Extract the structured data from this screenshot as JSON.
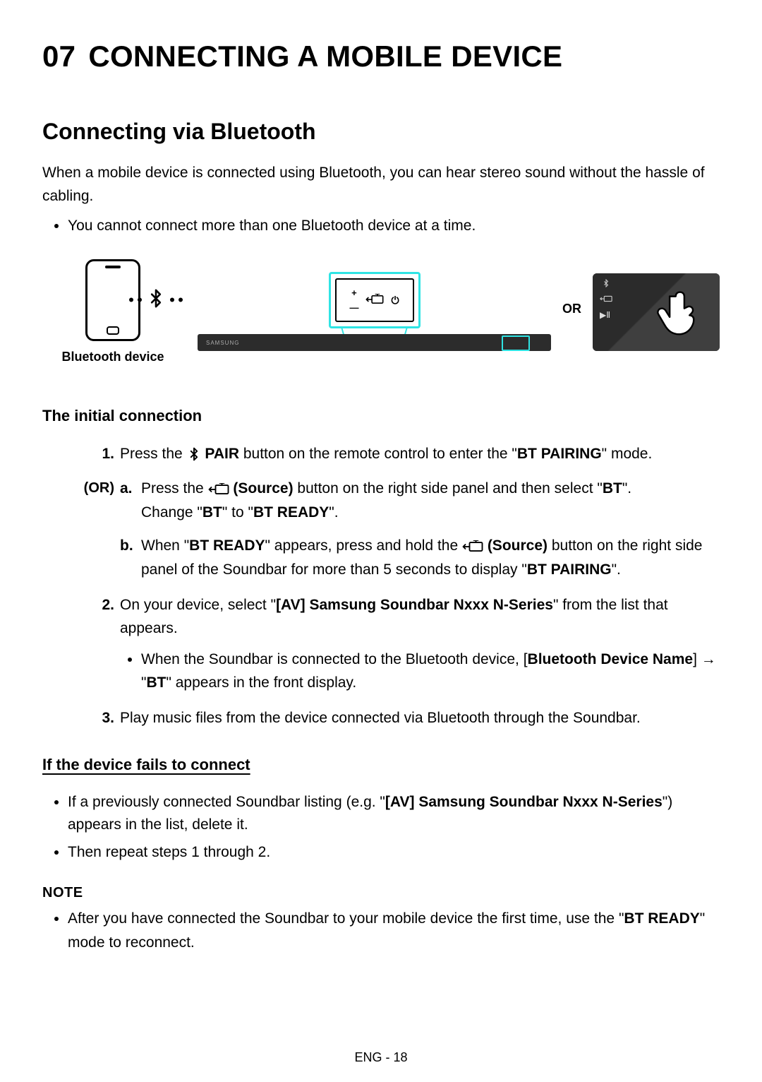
{
  "heading": {
    "number": "07",
    "title": "CONNECTING A MOBILE DEVICE"
  },
  "section1": {
    "title": "Connecting via Bluetooth",
    "intro": "When a mobile device is connected using Bluetooth, you can hear stereo sound without the hassle of cabling.",
    "bullet1": "You cannot connect more than one Bluetooth device at a time."
  },
  "figure": {
    "bt_caption": "Bluetooth device",
    "or_label": "OR",
    "soundbar_brand": "SAMSUNG"
  },
  "sub1": {
    "title": "The initial connection",
    "step1": {
      "num": "1.",
      "t1": "Press the ",
      "pair": " PAIR",
      "t2": " button on the remote control to enter the \"",
      "bt_pairing": "BT PAIRING",
      "t3": "\" mode."
    },
    "or_label": "(OR)",
    "stepA": {
      "letter": "a.",
      "t1": "Press the ",
      "source": " (Source)",
      "t2": " button on the right side panel and then select \"",
      "bt": "BT",
      "t3": "\".",
      "line2a": "Change \"",
      "bt2": "BT",
      "line2b": "\" to \"",
      "bt_ready": "BT READY",
      "line2c": "\"."
    },
    "stepB": {
      "letter": "b.",
      "t1": "When \"",
      "bt_ready": "BT READY",
      "t2": "\" appears, press and hold the ",
      "source": " (Source)",
      "t3": " button on the right side panel of the Soundbar for more than 5 seconds to display \"",
      "bt_pairing": "BT PAIRING",
      "t4": "\"."
    },
    "step2": {
      "num": "2.",
      "t1": "On your device, select \"",
      "device_name": "[AV] Samsung Soundbar Nxxx N-Series",
      "t2": "\" from the list that appears.",
      "bul_a": "When the Soundbar is connected to the Bluetooth device, [",
      "bul_b": "Bluetooth Device Name",
      "bul_c": "] → \"",
      "bul_d": "BT",
      "bul_e": "\" appears in the front display."
    },
    "step3": {
      "num": "3.",
      "t1": "Play music files from the device connected via Bluetooth through the Soundbar."
    }
  },
  "sub2": {
    "title": "If the device fails to connect",
    "b1a": "If a previously connected Soundbar listing (e.g. \"",
    "b1b": "[AV] Samsung Soundbar Nxxx N-Series",
    "b1c": "\") appears in the list, delete it.",
    "b2": "Then repeat steps 1 through 2."
  },
  "note": {
    "title": "NOTE",
    "b1a": "After you have connected the Soundbar to your mobile device the first time, use the \"",
    "b1b": "BT READY",
    "b1c": "\" mode to reconnect."
  },
  "footer": "ENG - 18"
}
